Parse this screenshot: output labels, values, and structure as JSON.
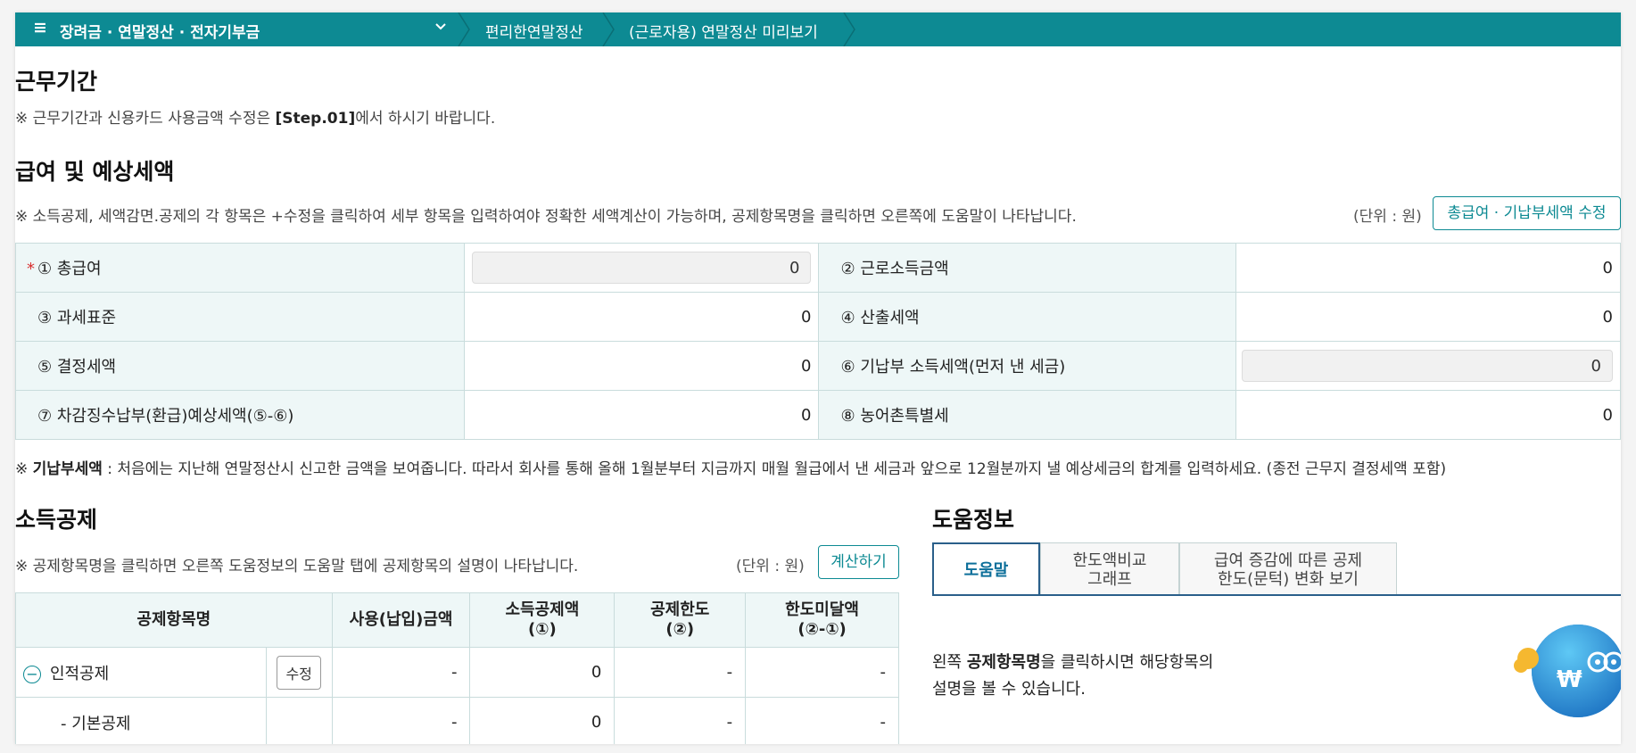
{
  "breadcrumb": {
    "menu": "장려금 · 연말정산 · 전자기부금",
    "item2": "편리한연말정산",
    "item3": "(근로자용) 연말정산 미리보기"
  },
  "work_period": {
    "title": "근무기간",
    "note_prefix": "※ 근무기간과 신용카드 사용금액 수정은 ",
    "note_bold": "[Step.01]",
    "note_suffix": "에서 하시기 바랍니다."
  },
  "salary": {
    "title": "급여 및 예상세액",
    "note": "※ 소득공제, 세액감면.공제의 각 항목은 +수정을 클릭하여 세부 항목을 입력하여야 정확한 세액계산이 가능하며, 공제항목명을 클릭하면 오른쪽에 도움말이 나타납니다.",
    "unit": "(단위 : 원)",
    "edit_button": "총급여 · 기납부세액 수정",
    "required_mark": "*",
    "rows": [
      {
        "l1": "① 총급여",
        "v1": "0",
        "l2": "② 근로소득금액",
        "v2": "0"
      },
      {
        "l1": "③ 과세표준",
        "v1": "0",
        "l2": "④ 산출세액",
        "v2": "0"
      },
      {
        "l1": "⑤ 결정세액",
        "v1": "0",
        "l2": "⑥ 기납부 소득세액(먼저 낸 세금)",
        "v2": "0"
      },
      {
        "l1": "⑦ 차감징수납부(환급)예상세액(⑤-⑥)",
        "v1": "0",
        "l2": "⑧ 농어촌특별세",
        "v2": "0"
      }
    ],
    "footnote_prefix": "※ ",
    "footnote_bold": "기납부세액",
    "footnote_text": " : 처음에는 지난해 연말정산시 신고한 금액을 보여줍니다. 따라서 회사를 통해 올해 1월분부터 지금까지 매월 월급에서 낸 세금과 앞으로 12월분까지 낼 예상세금의 합계를 입력하세요. (종전 근무지 결정세액 포함)"
  },
  "deduction": {
    "title": "소득공제",
    "note": "※ 공제항목명을 클릭하면 오른쪽 도움정보의 도움말 탭에 공제항목의 설명이 나타납니다.",
    "unit": "(단위 : 원)",
    "calc_button": "계산하기",
    "headers": {
      "name": "공제항목명",
      "used": "사용(납입)금액",
      "deduct_a": "소득공제액",
      "deduct_b": "(①)",
      "limit_a": "공제한도",
      "limit_b": "(②)",
      "remain_a": "한도미달액",
      "remain_b": "(②-①)"
    },
    "rows": [
      {
        "name": "인적공제",
        "edit": "수정",
        "used": "-",
        "deduct": "0",
        "limit": "-",
        "remain": "-"
      },
      {
        "name": "- 기본공제",
        "used": "-",
        "deduct": "0",
        "limit": "-",
        "remain": "-"
      }
    ]
  },
  "help": {
    "title": "도움정보",
    "tabs": [
      "도움말",
      "한도액비교\n그래프",
      "급여 증감에 따른 공제\n한도(문턱) 변화 보기"
    ],
    "tab1_l1": "한도액비교",
    "tab1_l2": "그래프",
    "tab2_l1": "급여 증감에 따른 공제",
    "tab2_l2": "한도(문턱) 변화 보기",
    "text_prefix": "왼쪽 ",
    "text_bold": "공제항목명",
    "text_mid": "을 클릭하시면 해당항목의",
    "text_line2": "설명을 볼 수 있습니다."
  },
  "colors": {
    "accent": "#0d8a93",
    "header_bg": "#eef7f7",
    "active_tab": "#2a5f8a"
  },
  "chatbot": {
    "icon": "won-robot-icon",
    "symbol": "₩"
  }
}
